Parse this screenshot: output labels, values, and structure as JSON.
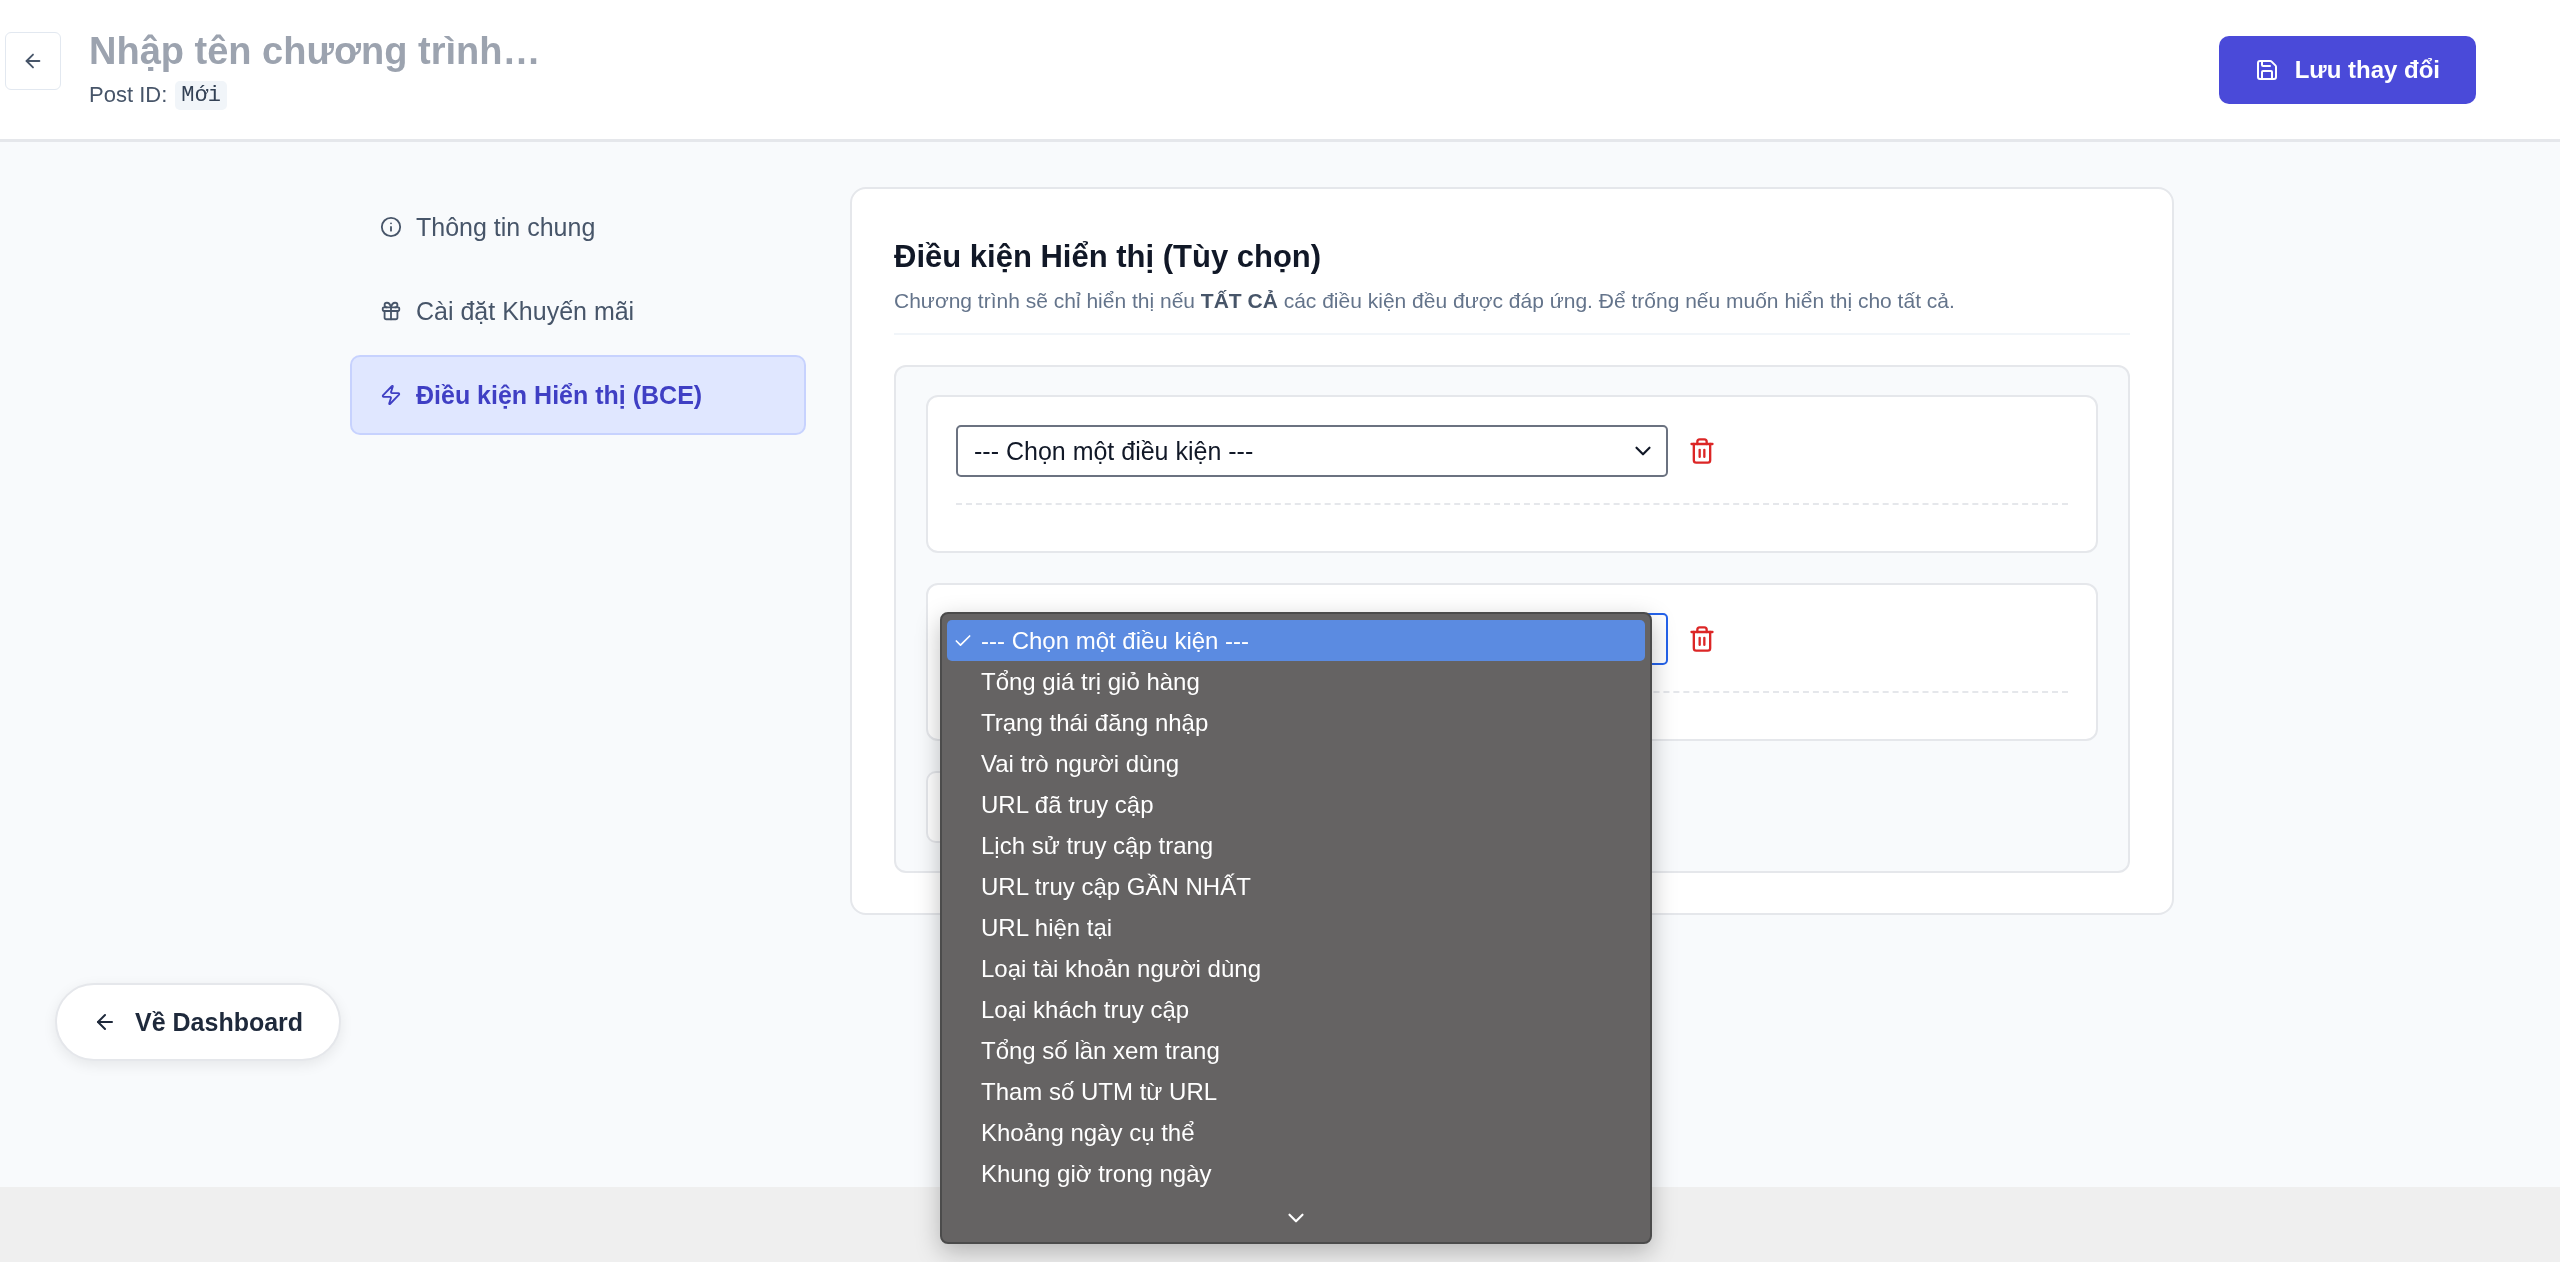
{
  "header": {
    "title_field": {
      "placeholder": "Nhập tên chương trình…"
    },
    "post_id_label": "Post ID:",
    "post_id": "Mới",
    "save_button": "Lưu thay đổi"
  },
  "sidebar": {
    "items": [
      {
        "label": "Thông tin chung",
        "selected": false
      },
      {
        "label": "Cài đặt Khuyến mãi",
        "selected": false
      },
      {
        "label": "Điều kiện Hiển thị (BCE)",
        "selected": true
      }
    ]
  },
  "section": {
    "title": "Điều kiện Hiển thị (Tùy chọn)",
    "description": "Chương trình sẽ chỉ hiển thị nếu **TẤT CẢ** các điều kiện đều được đáp ứng. Để trống nếu muốn hiển thị cho tất cả.",
    "conditions": [
      {
        "value": "--- Chọn một điều kiện ---",
        "open": false
      },
      {
        "open": true
      }
    ],
    "options": [
      {
        "label": "--- Chọn một điều kiện ---",
        "selected": true
      },
      {
        "label": "Tổng giá trị giỏ hàng",
        "selected": false
      },
      {
        "label": "Trạng thái đăng nhập",
        "selected": false
      },
      {
        "label": "Vai trò người dùng",
        "selected": false
      },
      {
        "label": "URL đã truy cập",
        "selected": false
      },
      {
        "label": "Lịch sử truy cập trang",
        "selected": false
      },
      {
        "label": "URL truy cập GẦN NHẤT",
        "selected": false
      },
      {
        "label": "URL hiện tại",
        "selected": false
      },
      {
        "label": "Loại tài khoản người dùng",
        "selected": false
      },
      {
        "label": "Loại khách truy cập",
        "selected": false
      },
      {
        "label": "Tổng số lần xem trang",
        "selected": false
      },
      {
        "label": "Tham số UTM từ URL",
        "selected": false
      },
      {
        "label": "Khoảng ngày cụ thể",
        "selected": false
      },
      {
        "label": "Khung giờ trong ngày",
        "selected": false
      }
    ]
  },
  "back_link": "Về Dashboard"
}
